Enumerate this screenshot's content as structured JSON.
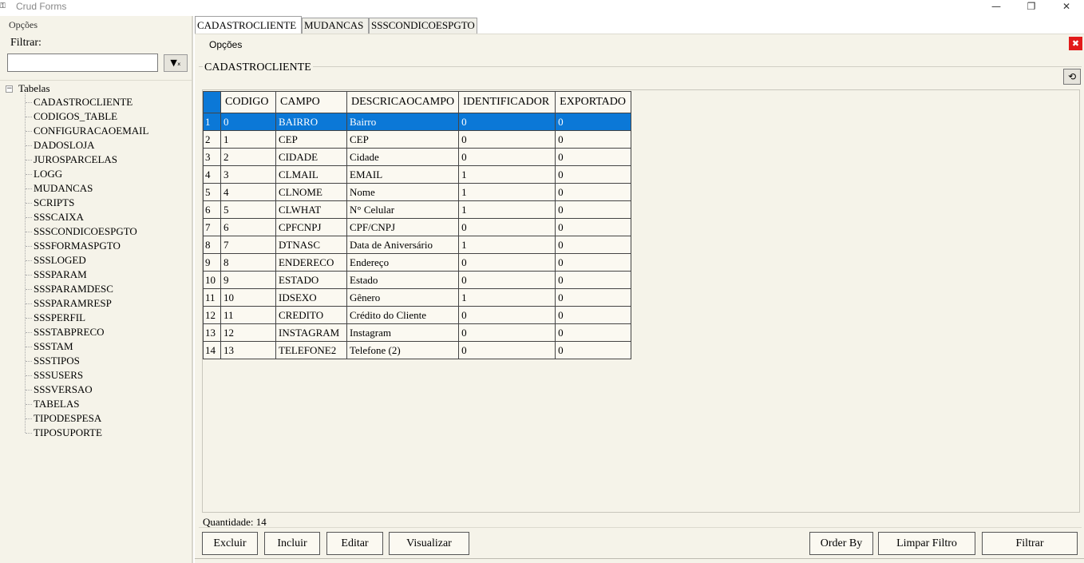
{
  "window": {
    "title": "Crud Forms",
    "app_icon": "key-icon",
    "minimize": "—",
    "restore": "❐",
    "close": "✕"
  },
  "left_panel": {
    "menu": "Opções",
    "filter_label": "Filtrar:",
    "filter_value": "",
    "filter_button_icon": "filter-clear-icon",
    "tree_root": "Tabelas",
    "tree_items": [
      "CADASTROCLIENTE",
      "CODIGOS_TABLE",
      "CONFIGURACAOEMAIL",
      "DADOSLOJA",
      "JUROSPARCELAS",
      "LOGG",
      "MUDANCAS",
      "SCRIPTS",
      "SSSCAIXA",
      "SSSCONDICOESPGTO",
      "SSSFORMASPGTO",
      "SSSLOGED",
      "SSSPARAM",
      "SSSPARAMDESC",
      "SSSPARAMRESP",
      "SSSPERFIL",
      "SSSTABPRECO",
      "SSSTAM",
      "SSSTIPOS",
      "SSSUSERS",
      "SSSVERSAO",
      "TABELAS",
      "TIPODESPESA",
      "TIPOSUPORTE"
    ]
  },
  "tabs": [
    "CADASTROCLIENTE",
    "MUDANCAS",
    "SSSCONDICOESPGTO"
  ],
  "content": {
    "menu": "Opções",
    "group_title": "CADASTROCLIENTE",
    "refresh_icon": "refresh-icon",
    "close_tab_icon": "close-tab-icon",
    "grid": {
      "columns": [
        "CODIGO",
        "CAMPO",
        "DESCRICAOCAMPO",
        "IDENTIFICADOR",
        "EXPORTADO"
      ],
      "selected_row": 0,
      "rows": [
        {
          "n": "1",
          "cells": [
            "0",
            "BAIRRO",
            "Bairro",
            "0",
            "0"
          ]
        },
        {
          "n": "2",
          "cells": [
            "1",
            "CEP",
            "CEP",
            "0",
            "0"
          ]
        },
        {
          "n": "3",
          "cells": [
            "2",
            "CIDADE",
            "Cidade",
            "0",
            "0"
          ]
        },
        {
          "n": "4",
          "cells": [
            "3",
            "CLMAIL",
            "EMAIL",
            "1",
            "0"
          ]
        },
        {
          "n": "5",
          "cells": [
            "4",
            "CLNOME",
            "Nome",
            "1",
            "0"
          ]
        },
        {
          "n": "6",
          "cells": [
            "5",
            "CLWHAT",
            "N° Celular",
            "1",
            "0"
          ]
        },
        {
          "n": "7",
          "cells": [
            "6",
            "CPFCNPJ",
            "CPF/CNPJ",
            "0",
            "0"
          ]
        },
        {
          "n": "8",
          "cells": [
            "7",
            "DTNASC",
            "Data de Aniversário",
            "1",
            "0"
          ]
        },
        {
          "n": "9",
          "cells": [
            "8",
            "ENDERECO",
            "Endereço",
            "0",
            "0"
          ]
        },
        {
          "n": "10",
          "cells": [
            "9",
            "ESTADO",
            "Estado",
            "0",
            "0"
          ]
        },
        {
          "n": "11",
          "cells": [
            "10",
            "IDSEXO",
            "Gênero",
            "1",
            "0"
          ]
        },
        {
          "n": "12",
          "cells": [
            "11",
            "CREDITO",
            "Crédito do Cliente",
            "0",
            "0"
          ]
        },
        {
          "n": "13",
          "cells": [
            "12",
            "INSTAGRAM",
            "Instagram",
            "0",
            "0"
          ]
        },
        {
          "n": "14",
          "cells": [
            "13",
            "TELEFONE2",
            "Telefone (2)",
            "0",
            "0"
          ]
        }
      ]
    },
    "quantidade": "Quantidade: 14",
    "buttons": {
      "excluir": "Excluir",
      "incluir": "Incluir",
      "editar": "Editar",
      "visualizar": "Visualizar",
      "order_by": "Order By",
      "limpar_filtro": "Limpar Filtro",
      "filtrar": "Filtrar"
    }
  },
  "colors": {
    "selection": "#0b78d7",
    "panel_bg": "#f5f3e9",
    "close_red": "#e21b1b"
  }
}
